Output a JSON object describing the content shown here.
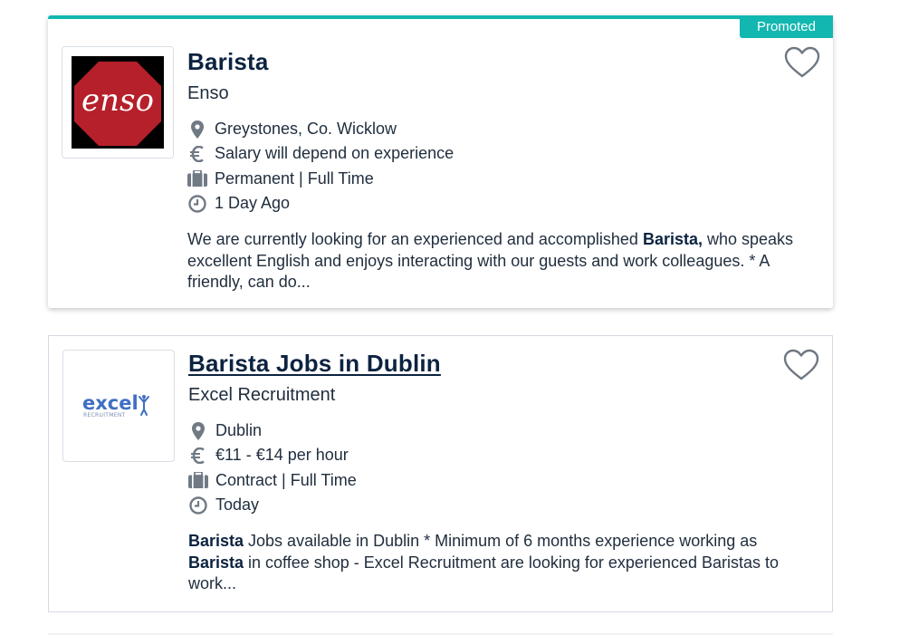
{
  "colors": {
    "accent": "#12b7b0",
    "title": "#0c2340",
    "text": "#1f2d3d",
    "icon": "#707a85",
    "enso_red": "#b5202a"
  },
  "jobs": [
    {
      "badge": "Promoted",
      "title": "Barista",
      "company": "Enso",
      "logo_text": "enso",
      "location": "Greystones, Co. Wicklow",
      "salary": "Salary will depend on experience",
      "type": "Permanent | Full Time",
      "posted": "1 Day Ago",
      "desc_pre": "We are currently looking for an experienced and accomplished ",
      "desc_bold": "Barista,",
      "desc_post": " who speaks excellent English and enjoys interacting with our guests and work colleagues. * A friendly, can do...",
      "icons": [
        "map-pin-icon",
        "euro-icon",
        "briefcase-icon",
        "clock-icon",
        "heart-icon"
      ]
    },
    {
      "title": "Barista Jobs in Dublin",
      "company": "Excel Recruitment",
      "logo_text": "excel",
      "logo_sub": "RECRUITMENT",
      "location": "Dublin",
      "salary": "€11 - €14 per hour",
      "type": "Contract | Full Time",
      "posted": "Today",
      "desc_bold1": "Barista",
      "desc_mid": " Jobs available in Dublin * Minimum of 6 months experience working as ",
      "desc_bold2": "Barista",
      "desc_post": " in coffee shop - Excel Recruitment are looking for experienced Baristas to work...",
      "icons": [
        "map-pin-icon",
        "euro-icon",
        "briefcase-icon",
        "clock-icon",
        "heart-icon"
      ]
    }
  ]
}
